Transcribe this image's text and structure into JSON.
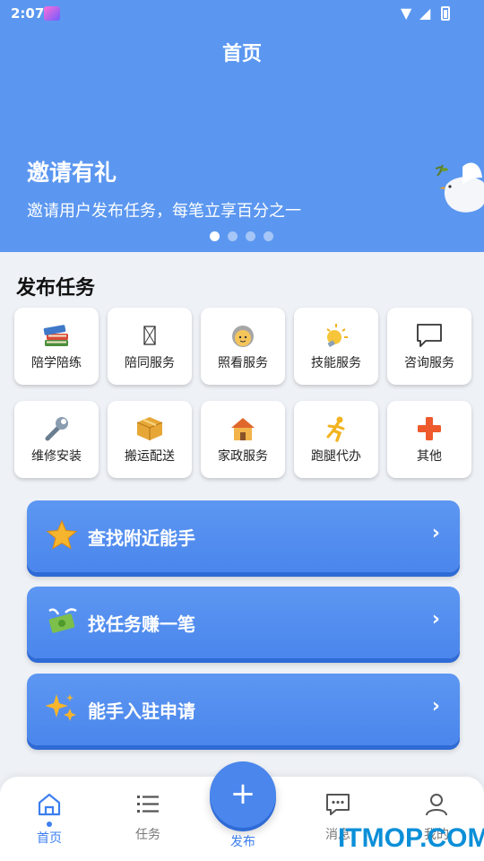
{
  "status_bar": {
    "time": "2:07"
  },
  "header": {
    "title": "首页"
  },
  "banner": {
    "headline": "邀请有礼",
    "subtitle": "邀请用户发布任务，每笔立享百分之一",
    "page_count": 4,
    "active_page": 1
  },
  "publish_section": {
    "title": "发布任务",
    "items": [
      {
        "label": "陪学陪练",
        "icon": "books-icon"
      },
      {
        "label": "陪同服务",
        "icon": "placeholder-icon"
      },
      {
        "label": "照看服务",
        "icon": "elder-icon"
      },
      {
        "label": "技能服务",
        "icon": "lightbulb-icon"
      },
      {
        "label": "咨询服务",
        "icon": "speech-bubble-icon"
      },
      {
        "label": "维修安装",
        "icon": "wrench-icon"
      },
      {
        "label": "搬运配送",
        "icon": "package-icon"
      },
      {
        "label": "家政服务",
        "icon": "house-icon"
      },
      {
        "label": "跑腿代办",
        "icon": "runner-icon"
      },
      {
        "label": "其他",
        "icon": "plus-icon"
      }
    ]
  },
  "actions": [
    {
      "label": "查找附近能手",
      "icon": "star-icon",
      "chevron": "›"
    },
    {
      "label": "找任务赚一笔",
      "icon": "flying-money-icon",
      "chevron": "›"
    },
    {
      "label": "能手入驻申请",
      "icon": "sparkles-icon",
      "chevron": "›"
    }
  ],
  "bottom_nav": {
    "items": [
      {
        "label": "首页",
        "icon": "home-icon",
        "active": true
      },
      {
        "label": "任务",
        "icon": "list-icon",
        "active": false
      },
      {
        "label": "发布",
        "icon": "plus-icon",
        "active": false
      },
      {
        "label": "消息",
        "icon": "chat-icon",
        "active": false
      },
      {
        "label": "我的",
        "icon": "user-icon",
        "active": false
      }
    ],
    "fab_symbol": "+"
  },
  "watermark": "ITMOP.COM",
  "colors": {
    "primary": "#5b97f0",
    "accent": "#3d7ff0",
    "background": "#eef1f6"
  }
}
